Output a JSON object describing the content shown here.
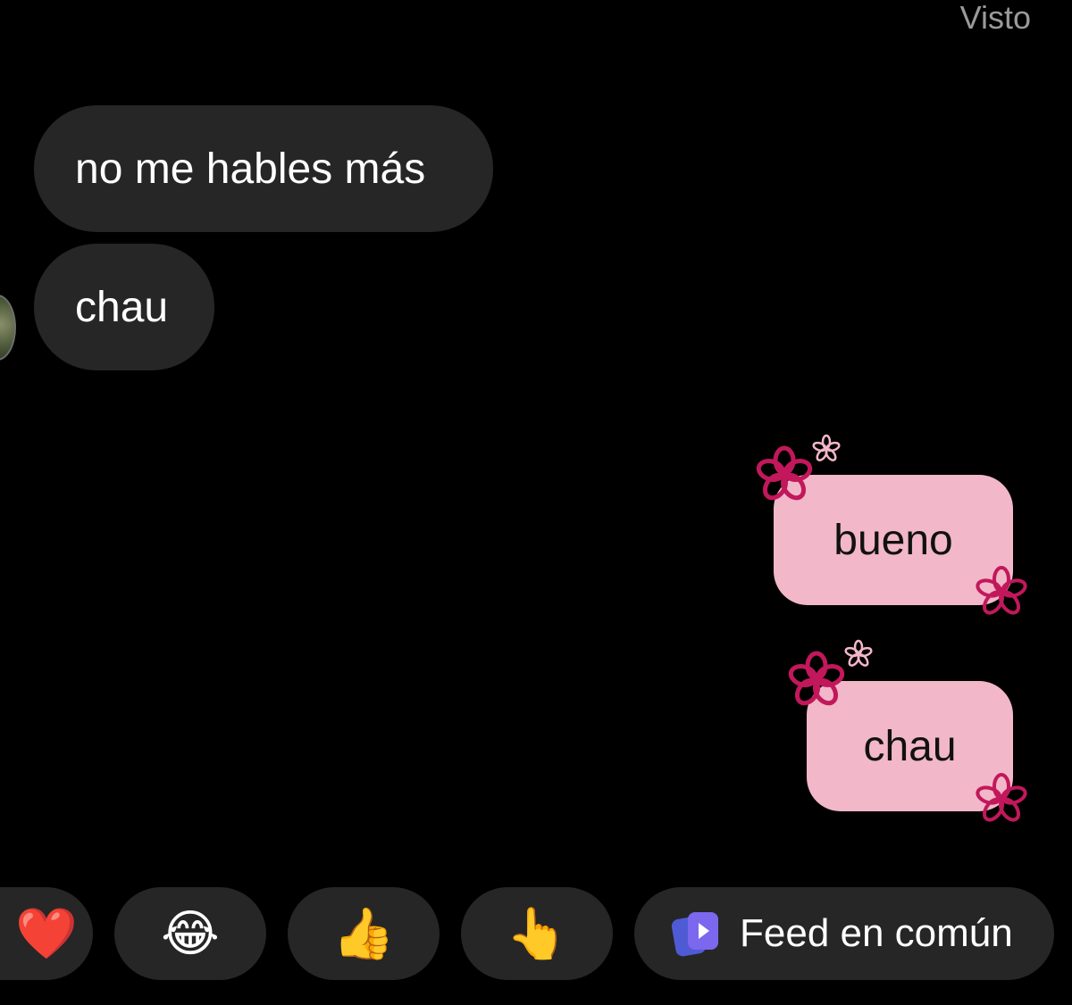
{
  "status": {
    "seen_label": "Visto"
  },
  "messages": {
    "incoming": [
      {
        "text": "no me hables más"
      },
      {
        "text": "chau"
      }
    ],
    "outgoing": [
      {
        "text": "bueno"
      },
      {
        "text": "chau"
      }
    ]
  },
  "colors": {
    "background": "#000000",
    "incoming_bubble": "#262626",
    "outgoing_bubble": "#f2b7c9",
    "flower_stroke": "#c2185b",
    "pill": "#262626",
    "feed_icon": "#7b68ee"
  },
  "quick_reactions": {
    "items": [
      {
        "name": "heart",
        "glyph": "❤️"
      },
      {
        "name": "laughing",
        "glyph": "😂"
      },
      {
        "name": "thumbs-up",
        "glyph": "👍"
      },
      {
        "name": "pointing",
        "glyph": "👆"
      }
    ],
    "feed_button": {
      "label": "Feed en común",
      "icon": "shared-feed-icon"
    }
  }
}
